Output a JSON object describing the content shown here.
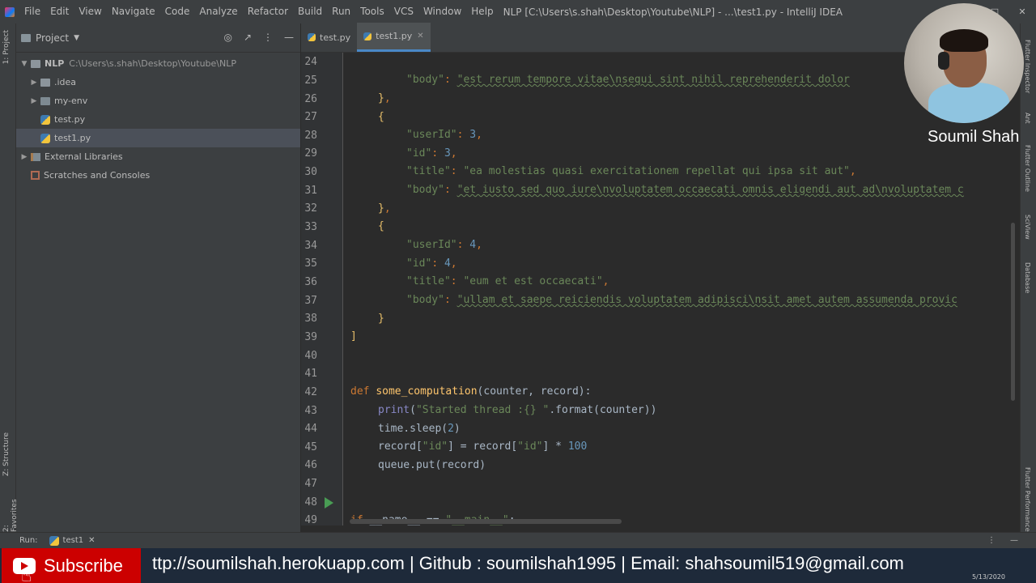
{
  "menubar": {
    "items": [
      "File",
      "Edit",
      "View",
      "Navigate",
      "Code",
      "Analyze",
      "Refactor",
      "Build",
      "Run",
      "Tools",
      "VCS",
      "Window",
      "Help"
    ],
    "window_title": "NLP [C:\\Users\\s.shah\\Desktop\\Youtube\\NLP] - ...\\test1.py - IntelliJ IDEA"
  },
  "left_stripe": {
    "project": "1: Project",
    "structure": "Z: Structure",
    "favorites": "2: Favorites"
  },
  "right_stripe": {
    "inspector": "Flutter Inspector",
    "ant": "Ant",
    "outline": "Flutter Outline",
    "sciview": "SciView",
    "database": "Database",
    "performance": "Flutter Performance"
  },
  "project_panel": {
    "title": "Project",
    "tree": [
      {
        "label": "NLP",
        "path": "C:\\Users\\s.shah\\Desktop\\Youtube\\NLP"
      },
      {
        "label": ".idea"
      },
      {
        "label": "my-env"
      },
      {
        "label": "test.py"
      },
      {
        "label": "test1.py"
      },
      {
        "label": "External Libraries"
      },
      {
        "label": "Scratches and Consoles"
      }
    ]
  },
  "tabs": [
    {
      "label": "test.py"
    },
    {
      "label": "test1.py"
    }
  ],
  "editor": {
    "line_numbers": [
      "24",
      "25",
      "26",
      "27",
      "28",
      "29",
      "30",
      "31",
      "32",
      "33",
      "34",
      "35",
      "36",
      "37",
      "38",
      "39",
      "40",
      "41",
      "42",
      "43",
      "44",
      "45",
      "46",
      "47",
      "48",
      "49"
    ],
    "lines": {
      "l24_key": "\"body\"",
      "l24_val": "\"est rerum tempore vitae\\nsequi sint nihil reprehenderit dolor",
      "l27_key": "\"userId\"",
      "l27_val": "3",
      "l28_key": "\"id\"",
      "l28_val": "3",
      "l29_key": "\"title\"",
      "l29_val": "\"ea molestias quasi exercitationem repellat qui ipsa sit aut\"",
      "l30_key": "\"body\"",
      "l30_val": "\"et iusto sed quo iure\\nvoluptatem occaecati omnis eligendi aut ad\\nvoluptatem c",
      "l33_key": "\"userId\"",
      "l33_val": "4",
      "l34_key": "\"id\"",
      "l34_val": "4",
      "l35_key": "\"title\"",
      "l35_val": "\"eum et est occaecati\"",
      "l36_key": "\"body\"",
      "l36_val": "\"ullam et saepe reiciendis voluptatem adipisci\\nsit amet autem assumenda provic",
      "l41_def": "def",
      "l41_name": "some_computation",
      "l41_args": "(counter, record):",
      "l42_print": "print",
      "l42_str": "\"Started thread :{} \"",
      "l42_rest": ".format(counter))",
      "l43": "time.sleep(",
      "l43_num": "2",
      "l43_end": ")",
      "l44_a": "record[",
      "l44_s1": "\"id\"",
      "l44_b": "] = record[",
      "l44_s2": "\"id\"",
      "l44_c": "] * ",
      "l44_num": "100",
      "l45": "queue.put(record)",
      "l48_if": "if",
      "l48_mid": " __name__ == ",
      "l48_str": "\"__main__\"",
      "l48_end": ":"
    }
  },
  "runbar": {
    "label": "Run:",
    "config": "test1"
  },
  "bottom": {
    "subscribe": "Subscribe",
    "banner": "ttp://soumilshah.herokuapp.com | Github : soumilshah1995 | Email: shahsoumil519@gmail.com",
    "date": "5/13/2020"
  },
  "presenter": {
    "name": "Soumil Shah"
  }
}
